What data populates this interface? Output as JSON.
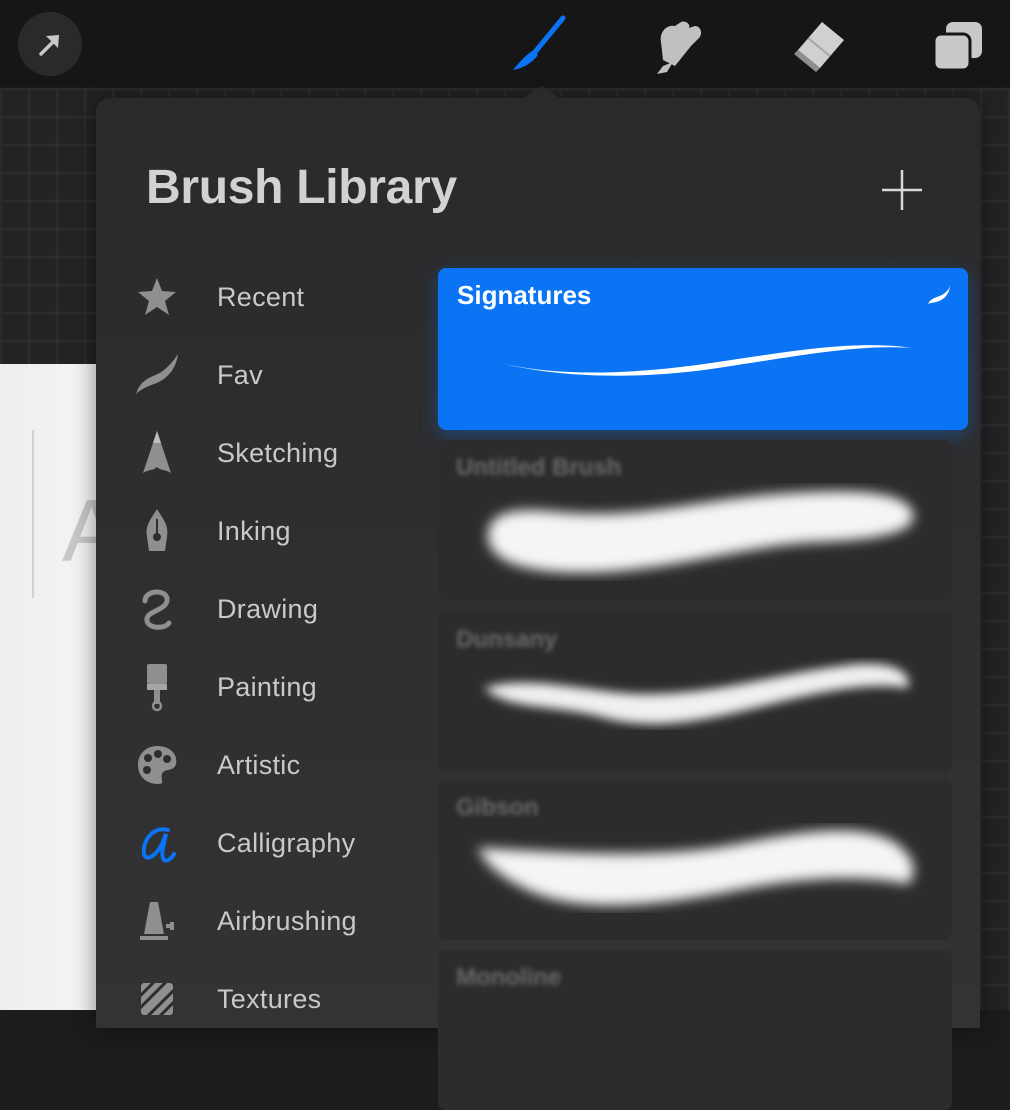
{
  "toolbar": {
    "tools": [
      {
        "name": "modify-icon"
      },
      {
        "name": "brush-icon",
        "active": true,
        "color": "#0a74f4"
      },
      {
        "name": "smudge-icon"
      },
      {
        "name": "eraser-icon"
      },
      {
        "name": "layers-icon"
      }
    ]
  },
  "panel": {
    "title": "Brush Library",
    "add_icon": "plus-icon"
  },
  "categories": [
    {
      "label": "Recent",
      "icon": "star-icon"
    },
    {
      "label": "Fav",
      "icon": "swoosh-icon"
    },
    {
      "label": "Sketching",
      "icon": "pencil-tip-icon"
    },
    {
      "label": "Inking",
      "icon": "pen-nib-icon"
    },
    {
      "label": "Drawing",
      "icon": "squiggle-icon"
    },
    {
      "label": "Painting",
      "icon": "paint-brush-icon"
    },
    {
      "label": "Artistic",
      "icon": "palette-icon"
    },
    {
      "label": "Calligraphy",
      "icon": "calligraphy-a-icon",
      "color": "#0a74f4"
    },
    {
      "label": "Airbrushing",
      "icon": "airbrush-icon"
    },
    {
      "label": "Textures",
      "icon": "texture-icon"
    }
  ],
  "brushes": [
    {
      "name": "Signatures",
      "selected": true
    },
    {
      "name": "Untitled Brush",
      "selected": false
    },
    {
      "name": "Dunsany",
      "selected": false
    },
    {
      "name": "Gibson",
      "selected": false
    },
    {
      "name": "Monoline",
      "selected": false
    }
  ],
  "canvas": {
    "partial_text": "A"
  },
  "colors": {
    "accent": "#0a74f4",
    "panel": "#2a2a2c",
    "text": "#c9c9cb"
  }
}
